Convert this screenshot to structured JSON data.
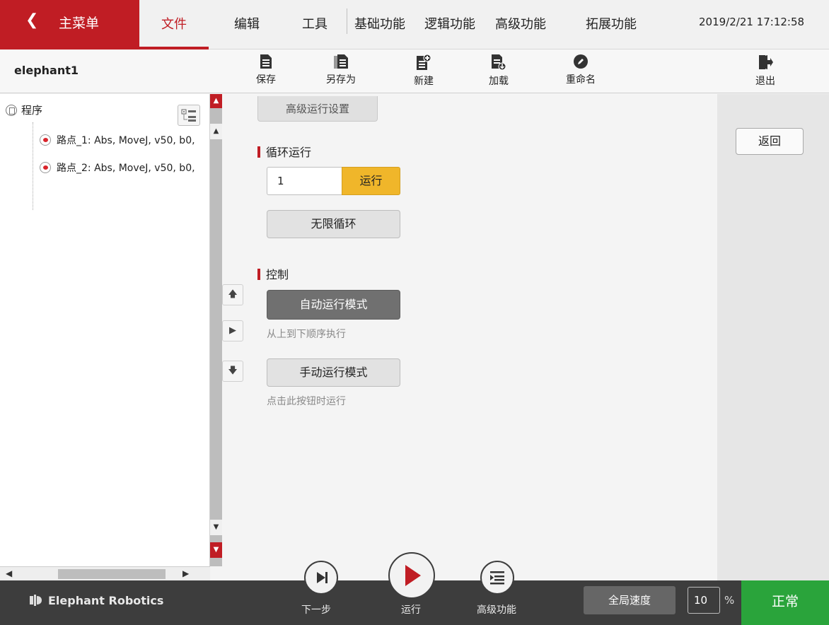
{
  "topbar": {
    "main_menu": "主菜单",
    "back_icon": "chevron-left-icon",
    "tabs": [
      "文件",
      "编辑",
      "工具"
    ],
    "function_tabs": [
      "基础功能",
      "逻辑功能",
      "高级功能",
      "拓展功能"
    ],
    "datetime": "2019/2/21 17:12:58",
    "active_color": "#c01d24"
  },
  "toolbar": {
    "filename": "elephant1",
    "buttons": [
      {
        "label": "保存",
        "icon": "save-file-icon"
      },
      {
        "label": "另存为",
        "icon": "save-as-icon"
      },
      {
        "label": "新建",
        "icon": "new-file-icon"
      },
      {
        "label": "加载",
        "icon": "load-file-icon"
      },
      {
        "label": "重命名",
        "icon": "rename-pencil-icon"
      },
      {
        "label": "退出",
        "icon": "exit-icon"
      }
    ]
  },
  "tree": {
    "root": "程序",
    "items": [
      "路点_1: Abs, MoveJ, v50, b0,",
      "路点_2: Abs, MoveJ, v50, b0,"
    ]
  },
  "content": {
    "advanced_settings": "高级运行设置",
    "loop_section": "循环运行",
    "loop_count": "1",
    "run_button": "运行",
    "infinite_loop": "无限循环",
    "control_section": "控制",
    "auto_mode": "自动运行模式",
    "auto_hint": "从上到下顺序执行",
    "manual_mode": "手动运行模式",
    "manual_hint": "点击此按钮时运行"
  },
  "right": {
    "back": "返回"
  },
  "bottombar": {
    "brand": "Elephant Robotics",
    "next_step": "下一步",
    "run": "运行",
    "advanced": "高级功能",
    "global_speed": "全局速度",
    "speed_value": "10",
    "speed_unit": "%",
    "status": "正常",
    "status_color": "#2aa43b",
    "run_color": "#c01d24"
  }
}
